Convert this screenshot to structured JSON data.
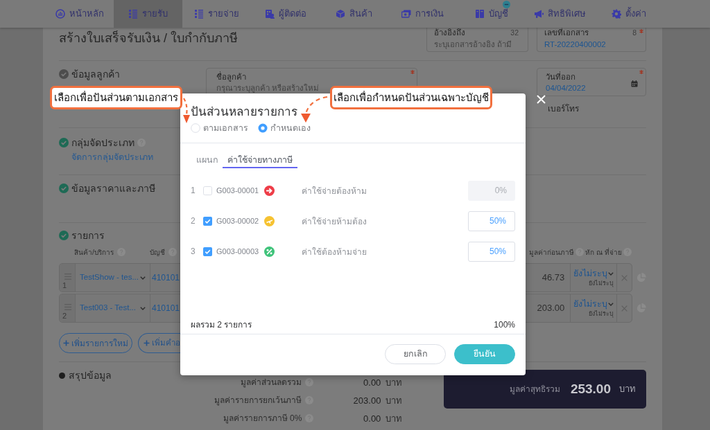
{
  "nav": {
    "items": [
      {
        "label": "หน้าหลัก",
        "selected": false,
        "badge": false
      },
      {
        "label": "รายรับ",
        "selected": true,
        "badge": false
      },
      {
        "label": "รายจ่าย",
        "selected": false,
        "badge": false
      },
      {
        "label": "ผู้ติดต่อ",
        "selected": false,
        "badge": false
      },
      {
        "label": "สินค้า",
        "selected": false,
        "badge": false
      },
      {
        "label": "การเงิน",
        "selected": false,
        "badge": false
      },
      {
        "label": "บัญชี",
        "selected": false,
        "badge": true
      },
      {
        "label": "สิทธิพิเศษ",
        "selected": false,
        "badge": false
      },
      {
        "label": "ตั้งค่า",
        "selected": false,
        "badge": false
      }
    ]
  },
  "header": {
    "title": "สร้างใบเสร็จรับเงิน / ใบกำกับภาษี",
    "fields": [
      {
        "label": "อ้างอิงถึง",
        "counter": "32",
        "placeholder": "ระบุเอกสารอ้างอิง ถ้ามี",
        "required": false
      },
      {
        "label": "เลขที่เอกสาร",
        "counter": "8",
        "value": "RT-20220400002",
        "required": true
      }
    ]
  },
  "customer_section": {
    "title": "ข้อมูลลูกค้า",
    "complete": false,
    "name_field": {
      "label": "ชื่อลูกค้า",
      "placeholder": "กรุณาระบุลูกค้า หรือสร้างใหม่",
      "required": true
    },
    "date_field": {
      "label": "วันที่ออก",
      "value": "04/04/2022",
      "required": true
    },
    "phone_label": "เบอร์โทร"
  },
  "classification_section": {
    "title": "กลุ่มจัดประเภท",
    "complete": true,
    "link": "จัดการกลุ่มจัดประเภท"
  },
  "pricing_section": {
    "title": "ข้อมูลราคาและภาษี",
    "complete": true
  },
  "items_section": {
    "title": "รายการ",
    "complete": true,
    "columns": [
      "สินค้า/บริการ",
      "บัญชี",
      "มูลค่าก่อนภาษี",
      "หัก ณ ที่จ่าย"
    ],
    "rows": [
      {
        "index": "1",
        "product": "TestShow - tes...",
        "account": "410101",
        "amount": "46.73",
        "withholding": "ยังไม่ระบุ",
        "withholding_note": "ยังไม่ระบุ"
      },
      {
        "index": "2",
        "product": "Test003 - Test...",
        "account": "410101",
        "amount": "203.00",
        "withholding": "ยังไม่ระบุ",
        "withholding_note": "ยังไม่ระบุ"
      }
    ],
    "buttons": [
      "เพิ่มรายการใหม่",
      "เพิ่มคำอ"
    ]
  },
  "summary_section": {
    "title": "สรุปข้อมูล",
    "lines": [
      {
        "label": "มูลค่าส่วนลดรวม",
        "value": "0.00",
        "unit": "บาท"
      },
      {
        "label": "มูลค่ารายการยกเว้นภาษี",
        "value": "203.00",
        "unit": "บาท"
      },
      {
        "label": "มูลค่ารายการภาษี 0%",
        "value": "0.00",
        "unit": "บาท"
      }
    ],
    "total": {
      "label": "มูลค่าสุทธิรวม",
      "value": "253.00",
      "unit": "บาท"
    }
  },
  "modal": {
    "title": "ปันส่วนหลายรายการ",
    "modes": [
      {
        "label": "ตามเอกสาร",
        "selected": false
      },
      {
        "label": "กำหนดเอง",
        "selected": true
      }
    ],
    "tabs": [
      {
        "label": "แผนก",
        "selected": false
      },
      {
        "label": "ค่าใช้จ่ายทางภาษี",
        "selected": true
      }
    ],
    "rows": [
      {
        "index": "1",
        "checked": false,
        "code": "G003-00001",
        "color": "#ee3d48",
        "name": "ค่าใช้จ่ายต้องห้าม",
        "share": "0%"
      },
      {
        "index": "2",
        "checked": true,
        "code": "G003-00002",
        "color": "#f6c231",
        "name": "ค่าใช้จ่ายห้ามต้อง",
        "share": "50%"
      },
      {
        "index": "3",
        "checked": true,
        "code": "G003-00003",
        "color": "#3fc37a",
        "name": "ค่าใช้ต้องห้ามจ่าย",
        "share": "50%"
      }
    ],
    "total_label": "ผลรวม 2 รายการ",
    "total_value": "100%",
    "buttons": [
      {
        "label": "ยกเลิก",
        "kind": "secondary"
      },
      {
        "label": "ยืนยัน",
        "kind": "primary"
      }
    ]
  },
  "annotations": [
    {
      "text": "เลือกเพื่อปันส่วนตามเอกสาร"
    },
    {
      "text": "เลือกเพื่อกำหนดปันส่วนเฉพาะบัญชี"
    }
  ]
}
